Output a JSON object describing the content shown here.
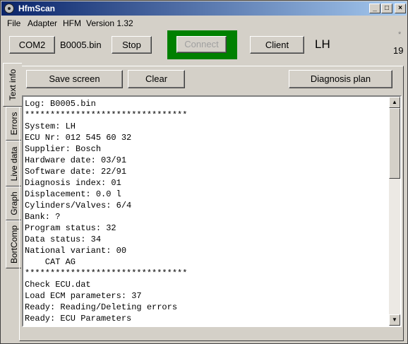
{
  "window": {
    "title": "HfmScan"
  },
  "titlebar_buttons": {
    "minimize": "_",
    "maximize": "□",
    "close": "×"
  },
  "menu": {
    "file": "File",
    "adapter": "Adapter",
    "hfm": "HFM",
    "version": "Version 1.32"
  },
  "toolbar": {
    "port_label": "COM2",
    "file_name": "B0005.bin",
    "stop_label": "Stop",
    "connect_label": "Connect",
    "client_label": "Client",
    "system_code": "LH",
    "corner_mark": "*",
    "counter": "19"
  },
  "tabs": [
    "Text info",
    "Errors",
    "Live data",
    "Graph",
    "BortComp"
  ],
  "actions": {
    "save": "Save screen",
    "clear": "Clear",
    "diagnosis": "Diagnosis plan"
  },
  "log_lines": [
    "Log: B0005.bin",
    "********************************",
    "System: LH",
    "ECU Nr: 012 545 60 32",
    "Supplier: Bosch",
    "Hardware date: 03/91",
    "Software date: 22/91",
    "Diagnosis index: 01",
    "Displacement: 0.0 l",
    "Cylinders/Valves: 6/4",
    "Bank: ?",
    "Program status: 32",
    "Data status: 34",
    "National variant: 00",
    "    CAT AG",
    "********************************",
    "Check ECU.dat",
    "Load ECM parameters: 37",
    "Ready: Reading/Deleting errors",
    "Ready: ECU Parameters"
  ],
  "icons": {
    "app": "hfmscan-app-icon",
    "scroll_up": "arrow-up-icon",
    "scroll_down": "arrow-down-icon"
  },
  "colors": {
    "connect_frame": "#008000",
    "titlebar_start": "#0a246a",
    "titlebar_end": "#a6caf0"
  }
}
